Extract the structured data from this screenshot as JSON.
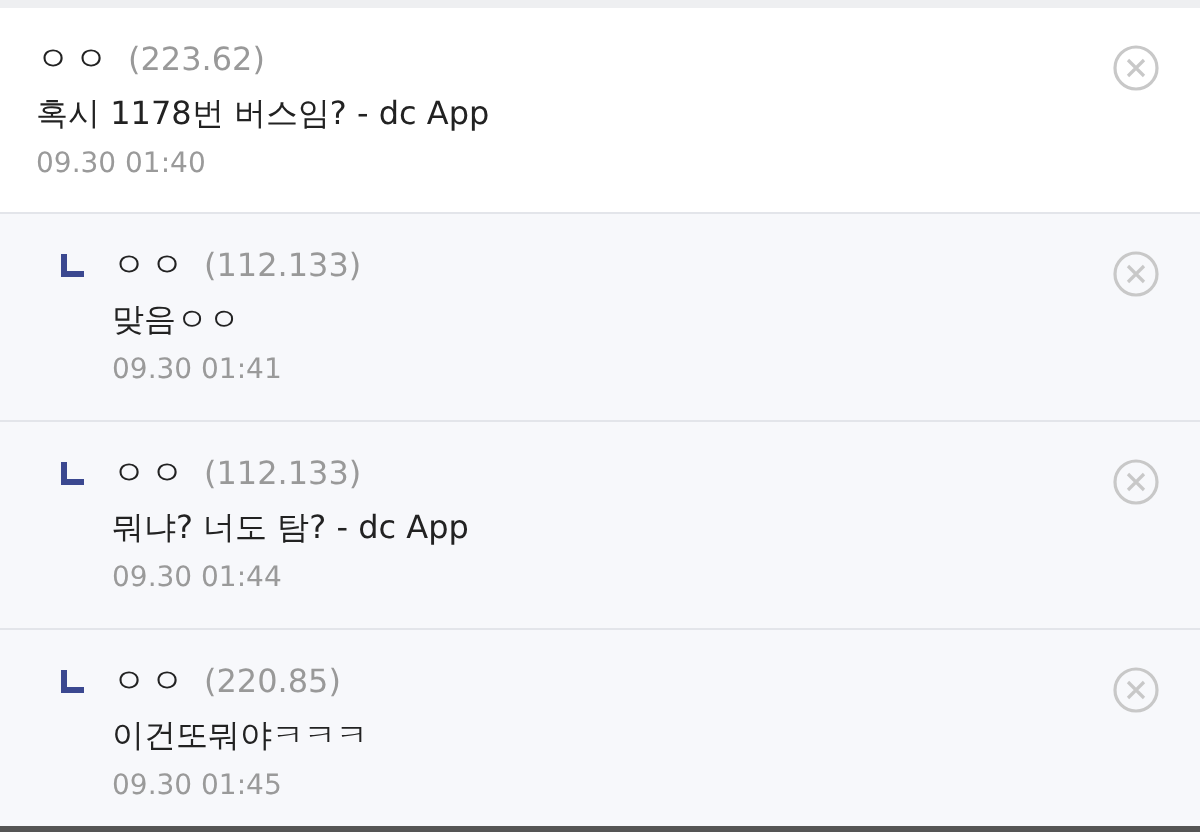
{
  "comments": [
    {
      "kind": "comment",
      "author": "ㅇㅇ",
      "ip": "(223.62)",
      "text": "혹시 1178번 버스임? - dc App",
      "date": "09.30 01:40"
    },
    {
      "kind": "reply",
      "author": "ㅇㅇ",
      "ip": "(112.133)",
      "text": "맞음ㅇㅇ",
      "date": "09.30 01:41"
    },
    {
      "kind": "reply",
      "author": "ㅇㅇ",
      "ip": "(112.133)",
      "text": "뭐냐? 너도 탐? - dc App",
      "date": "09.30 01:44"
    },
    {
      "kind": "reply",
      "author": "ㅇㅇ",
      "ip": "(220.85)",
      "text": "이건또뭐야ㅋㅋㅋ",
      "date": "09.30 01:45"
    }
  ]
}
